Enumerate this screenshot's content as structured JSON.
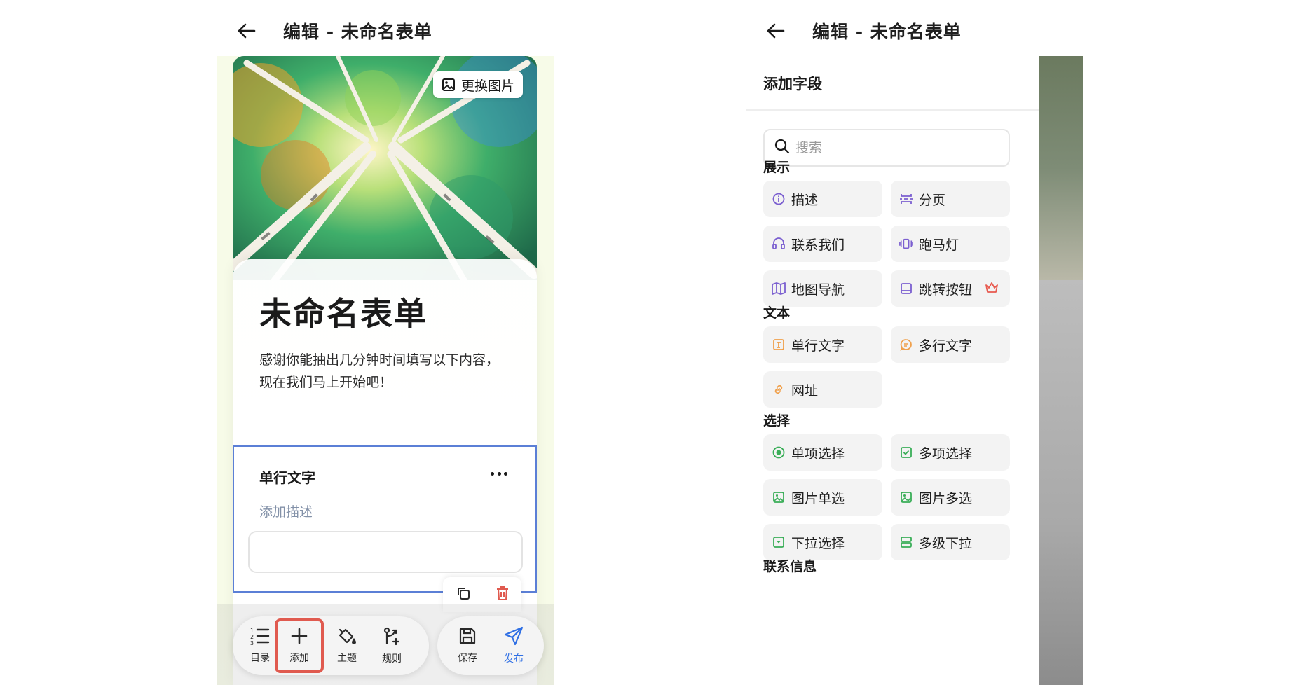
{
  "left": {
    "header": {
      "title": "编辑 - 未命名表单"
    },
    "cover": {
      "change_image_label": "更换图片"
    },
    "form": {
      "title": "未命名表单",
      "description": "感谢你能抽出几分钟时间填写以下内容，现在我们马上开始吧！"
    },
    "field": {
      "label": "单行文字",
      "add_desc": "添加描述"
    },
    "toolbar": {
      "catalog": "目录",
      "add": "添加",
      "theme": "主题",
      "rules": "规则",
      "save": "保存",
      "publish": "发布"
    }
  },
  "right": {
    "header": {
      "title": "编辑 - 未命名表单"
    },
    "panel_title": "添加字段",
    "search": {
      "placeholder": "搜索"
    },
    "sections": {
      "display": {
        "title": "展示",
        "items": [
          "描述",
          "分页",
          "联系我们",
          "跑马灯",
          "地图导航",
          "跳转按钮"
        ]
      },
      "text": {
        "title": "文本",
        "items": [
          "单行文字",
          "多行文字",
          "网址"
        ]
      },
      "choice": {
        "title": "选择",
        "items": [
          "单项选择",
          "多项选择",
          "图片单选",
          "图片多选",
          "下拉选择",
          "多级下拉"
        ]
      },
      "contact": {
        "title": "联系信息"
      }
    },
    "colors": {
      "display_icon": "#7b5fd0",
      "text_icon": "#f0a04b",
      "choice_icon": "#3aae58",
      "crown": "#e85a4f"
    }
  },
  "colors": {
    "selected_border": "#5b7fd6",
    "highlight_red": "#e05a4f",
    "publish_blue": "#2f6fe4"
  }
}
